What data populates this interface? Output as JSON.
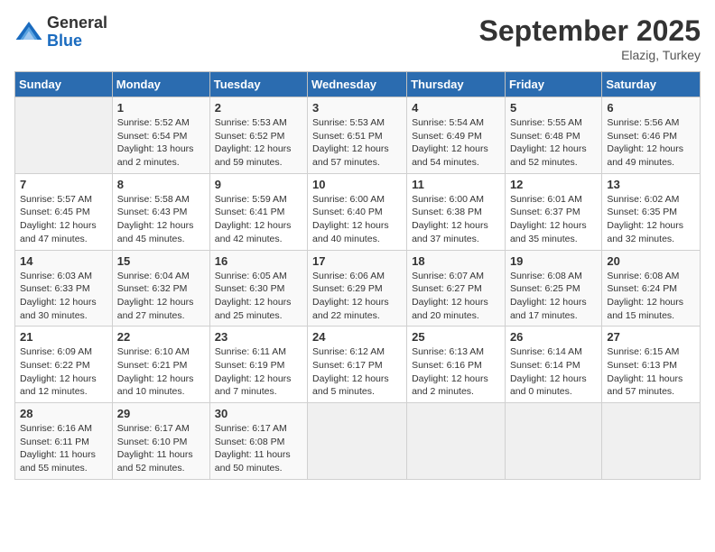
{
  "header": {
    "logo_general": "General",
    "logo_blue": "Blue",
    "month_title": "September 2025",
    "subtitle": "Elazig, Turkey"
  },
  "days_of_week": [
    "Sunday",
    "Monday",
    "Tuesday",
    "Wednesday",
    "Thursday",
    "Friday",
    "Saturday"
  ],
  "weeks": [
    [
      {
        "day": "",
        "info": ""
      },
      {
        "day": "1",
        "info": "Sunrise: 5:52 AM\nSunset: 6:54 PM\nDaylight: 13 hours\nand 2 minutes."
      },
      {
        "day": "2",
        "info": "Sunrise: 5:53 AM\nSunset: 6:52 PM\nDaylight: 12 hours\nand 59 minutes."
      },
      {
        "day": "3",
        "info": "Sunrise: 5:53 AM\nSunset: 6:51 PM\nDaylight: 12 hours\nand 57 minutes."
      },
      {
        "day": "4",
        "info": "Sunrise: 5:54 AM\nSunset: 6:49 PM\nDaylight: 12 hours\nand 54 minutes."
      },
      {
        "day": "5",
        "info": "Sunrise: 5:55 AM\nSunset: 6:48 PM\nDaylight: 12 hours\nand 52 minutes."
      },
      {
        "day": "6",
        "info": "Sunrise: 5:56 AM\nSunset: 6:46 PM\nDaylight: 12 hours\nand 49 minutes."
      }
    ],
    [
      {
        "day": "7",
        "info": "Sunrise: 5:57 AM\nSunset: 6:45 PM\nDaylight: 12 hours\nand 47 minutes."
      },
      {
        "day": "8",
        "info": "Sunrise: 5:58 AM\nSunset: 6:43 PM\nDaylight: 12 hours\nand 45 minutes."
      },
      {
        "day": "9",
        "info": "Sunrise: 5:59 AM\nSunset: 6:41 PM\nDaylight: 12 hours\nand 42 minutes."
      },
      {
        "day": "10",
        "info": "Sunrise: 6:00 AM\nSunset: 6:40 PM\nDaylight: 12 hours\nand 40 minutes."
      },
      {
        "day": "11",
        "info": "Sunrise: 6:00 AM\nSunset: 6:38 PM\nDaylight: 12 hours\nand 37 minutes."
      },
      {
        "day": "12",
        "info": "Sunrise: 6:01 AM\nSunset: 6:37 PM\nDaylight: 12 hours\nand 35 minutes."
      },
      {
        "day": "13",
        "info": "Sunrise: 6:02 AM\nSunset: 6:35 PM\nDaylight: 12 hours\nand 32 minutes."
      }
    ],
    [
      {
        "day": "14",
        "info": "Sunrise: 6:03 AM\nSunset: 6:33 PM\nDaylight: 12 hours\nand 30 minutes."
      },
      {
        "day": "15",
        "info": "Sunrise: 6:04 AM\nSunset: 6:32 PM\nDaylight: 12 hours\nand 27 minutes."
      },
      {
        "day": "16",
        "info": "Sunrise: 6:05 AM\nSunset: 6:30 PM\nDaylight: 12 hours\nand 25 minutes."
      },
      {
        "day": "17",
        "info": "Sunrise: 6:06 AM\nSunset: 6:29 PM\nDaylight: 12 hours\nand 22 minutes."
      },
      {
        "day": "18",
        "info": "Sunrise: 6:07 AM\nSunset: 6:27 PM\nDaylight: 12 hours\nand 20 minutes."
      },
      {
        "day": "19",
        "info": "Sunrise: 6:08 AM\nSunset: 6:25 PM\nDaylight: 12 hours\nand 17 minutes."
      },
      {
        "day": "20",
        "info": "Sunrise: 6:08 AM\nSunset: 6:24 PM\nDaylight: 12 hours\nand 15 minutes."
      }
    ],
    [
      {
        "day": "21",
        "info": "Sunrise: 6:09 AM\nSunset: 6:22 PM\nDaylight: 12 hours\nand 12 minutes."
      },
      {
        "day": "22",
        "info": "Sunrise: 6:10 AM\nSunset: 6:21 PM\nDaylight: 12 hours\nand 10 minutes."
      },
      {
        "day": "23",
        "info": "Sunrise: 6:11 AM\nSunset: 6:19 PM\nDaylight: 12 hours\nand 7 minutes."
      },
      {
        "day": "24",
        "info": "Sunrise: 6:12 AM\nSunset: 6:17 PM\nDaylight: 12 hours\nand 5 minutes."
      },
      {
        "day": "25",
        "info": "Sunrise: 6:13 AM\nSunset: 6:16 PM\nDaylight: 12 hours\nand 2 minutes."
      },
      {
        "day": "26",
        "info": "Sunrise: 6:14 AM\nSunset: 6:14 PM\nDaylight: 12 hours\nand 0 minutes."
      },
      {
        "day": "27",
        "info": "Sunrise: 6:15 AM\nSunset: 6:13 PM\nDaylight: 11 hours\nand 57 minutes."
      }
    ],
    [
      {
        "day": "28",
        "info": "Sunrise: 6:16 AM\nSunset: 6:11 PM\nDaylight: 11 hours\nand 55 minutes."
      },
      {
        "day": "29",
        "info": "Sunrise: 6:17 AM\nSunset: 6:10 PM\nDaylight: 11 hours\nand 52 minutes."
      },
      {
        "day": "30",
        "info": "Sunrise: 6:17 AM\nSunset: 6:08 PM\nDaylight: 11 hours\nand 50 minutes."
      },
      {
        "day": "",
        "info": ""
      },
      {
        "day": "",
        "info": ""
      },
      {
        "day": "",
        "info": ""
      },
      {
        "day": "",
        "info": ""
      }
    ]
  ]
}
